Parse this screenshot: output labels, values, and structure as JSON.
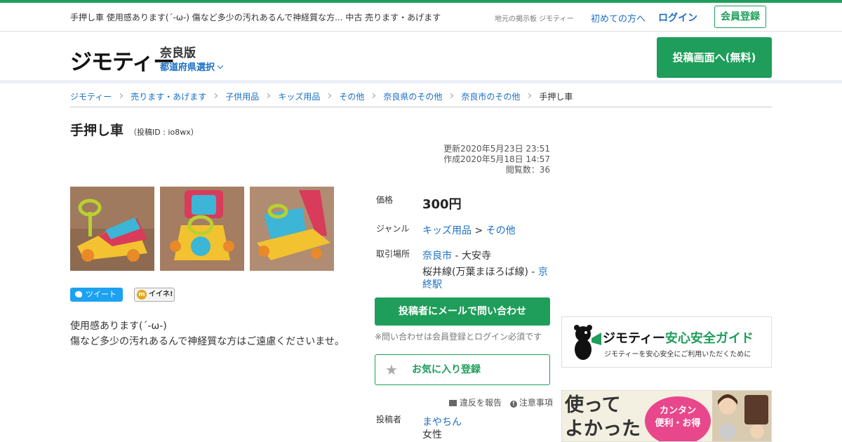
{
  "subhead": {
    "seo_title": "手押し車 使用感あります(´-ω-) 傷など多少の汚れあるんで神経質な方... 中古 売ります・あげます",
    "board": "地元の掲示板 ジモティー",
    "first_time": "初めての方へ",
    "login": "ログイン",
    "register": "会員登録"
  },
  "header": {
    "logo": "ジモティー",
    "region": "奈良版",
    "pref_select": "都道府県選択",
    "post_button": "投稿画面へ(無料)"
  },
  "breadcrumb": [
    "ジモティー",
    "売ります・あげます",
    "子供用品",
    "キッズ用品",
    "その他",
    "奈良県のその他",
    "奈良市のその他"
  ],
  "breadcrumb_current": "手押し車",
  "post": {
    "title": "手押し車",
    "post_id": "（投稿ID : io8wx）",
    "updated": "更新2020年5月23日 23:51",
    "created": "作成2020年5月18日 14:57",
    "views": "閲覧数：36",
    "description_1": "使用感あります(´-ω-)",
    "description_2": "傷など多少の汚れあるんで神経質な方はご遠慮くださいませ。"
  },
  "share": {
    "tweet": "ツイート",
    "iine": "イイネ!",
    "iine_mark": "m"
  },
  "details": {
    "price_label": "価格",
    "price": "300円",
    "genre_label": "ジャンル",
    "genre_1": "キッズ用品",
    "genre_sep": ">",
    "genre_2": "その他",
    "place_label": "取引場所",
    "place_city": "奈良市",
    "place_area": "- 大安寺",
    "place_line": "桜井線(万葉まほろば線) -",
    "place_station": "京終駅",
    "poster_label": "投稿者",
    "poster_name": "まやちん",
    "poster_gender": "女性"
  },
  "actions": {
    "mail_button": "投稿者にメールで問い合わせ",
    "mail_note": "※問い合わせは会員登録とログイン必須です",
    "favorite_button": "お気に入り登録",
    "report": "違反を報告",
    "notice": "注意事項"
  },
  "ads": {
    "guide_brand": "ジモティー",
    "guide_title": "安心安全ガイド",
    "guide_sub": "ジモティーを安心安全にご利用いただくために",
    "banner_line1": "使って",
    "banner_line2": "よかった",
    "banner_bubble1": "カンタン",
    "banner_bubble2": "便利・お得"
  },
  "colors": {
    "accent_green": "#1e9e5a",
    "link_blue": "#1a6fc4",
    "twitter_blue": "#1da1f2"
  }
}
